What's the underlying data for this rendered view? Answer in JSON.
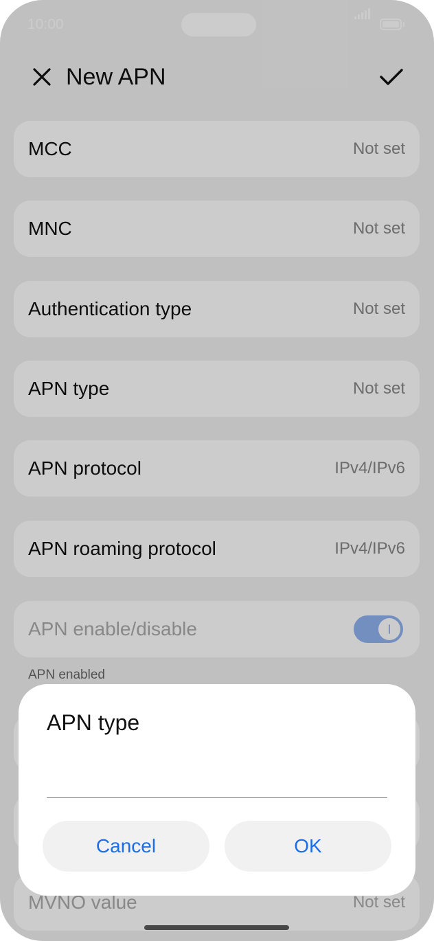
{
  "status_bar": {
    "time": "10:00"
  },
  "toolbar": {
    "title": "New APN"
  },
  "settings": [
    {
      "label": "MCC",
      "value": "Not set"
    },
    {
      "label": "MNC",
      "value": "Not set"
    },
    {
      "label": "Authentication type",
      "value": "Not set"
    },
    {
      "label": "APN type",
      "value": "Not set"
    },
    {
      "label": "APN protocol",
      "value": "IPv4/IPv6"
    },
    {
      "label": "APN roaming protocol",
      "value": "IPv4/IPv6"
    }
  ],
  "apn_toggle": {
    "label": "APN enable/disable",
    "caption": "APN enabled",
    "enabled": true
  },
  "mvno_value": {
    "label": "MVNO value",
    "value": "Not set"
  },
  "dialog": {
    "title": "APN type",
    "input_value": "",
    "cancel_label": "Cancel",
    "ok_label": "OK"
  },
  "colors": {
    "accent": "#1a6fe8",
    "toggle_on": "#8fb3f0",
    "background": "#f1f1f1",
    "card": "#ffffff"
  },
  "icons": {
    "close": "close-icon",
    "confirm": "checkmark-icon"
  }
}
